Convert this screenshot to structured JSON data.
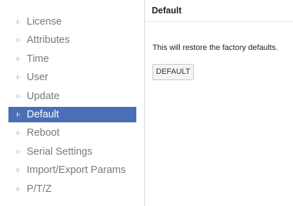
{
  "sidebar": {
    "items": [
      {
        "label": "License"
      },
      {
        "label": "Attributes"
      },
      {
        "label": "Time"
      },
      {
        "label": "User"
      },
      {
        "label": "Update"
      },
      {
        "label": "Default"
      },
      {
        "label": "Reboot"
      },
      {
        "label": "Serial Settings"
      },
      {
        "label": "Import/Export Params"
      },
      {
        "label": "P/T/Z"
      }
    ],
    "active_index": 5,
    "item_icon": "triangle-right-icon",
    "active_color": "#4b6fb5",
    "text_color": "#7a7a7a"
  },
  "main": {
    "title": "Default",
    "description": "This will restore the factory defaults.",
    "button_label": "DEFAULT"
  }
}
